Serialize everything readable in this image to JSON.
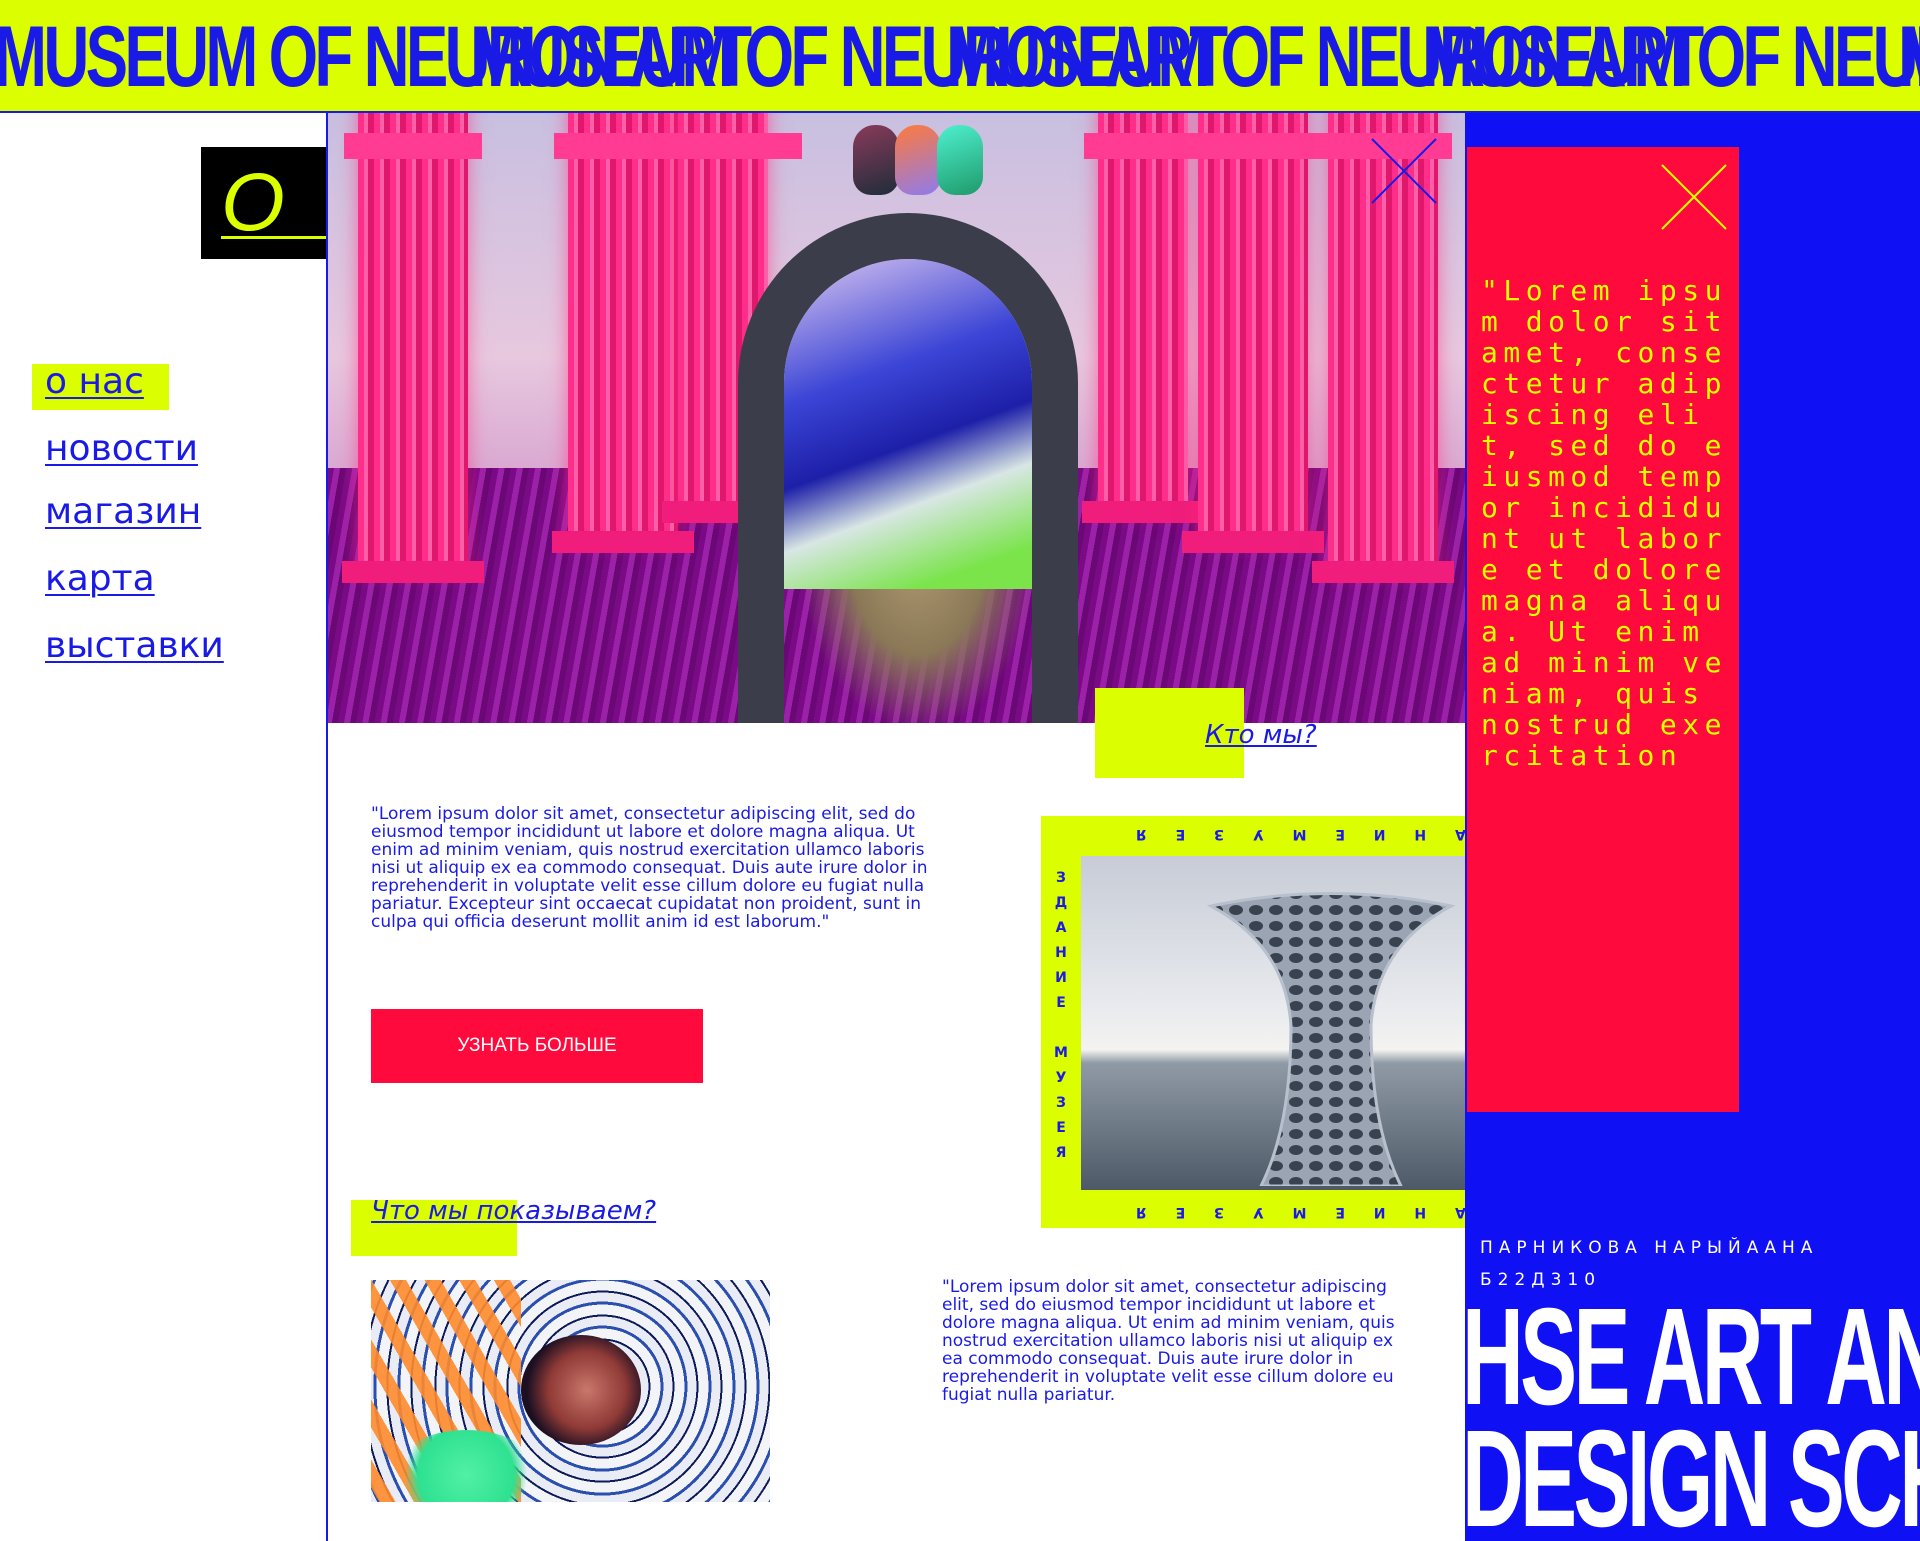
{
  "marquee": {
    "text": "MUSEUM OF NEURON ART",
    "repeats": 5
  },
  "page_title": "О НАС",
  "nav": {
    "active": 0,
    "items": [
      {
        "label": "о нас"
      },
      {
        "label": "новости"
      },
      {
        "label": "магазин"
      },
      {
        "label": "карта"
      },
      {
        "label": "выставки"
      }
    ]
  },
  "sections": {
    "who": {
      "heading": "Кто мы?"
    },
    "what": {
      "heading": "Что мы показываем?"
    }
  },
  "paragraphs": {
    "about": "\"Lorem ipsum dolor sit amet, consectetur adipiscing elit, sed do eiusmod tempor incididunt ut labore et dolore magna aliqua. Ut enim ad minim veniam, quis nostrud exercitation ullamco laboris nisi ut aliquip ex ea commodo consequat. Duis aute irure dolor in reprehenderit in voluptate velit esse cillum dolore eu fugiat nulla pariatur. Excepteur sint occaecat cupidatat non proident, sunt in culpa qui officia deserunt mollit anim id est laborum.\"",
    "show": "\"Lorem ipsum dolor sit amet, consectetur adipiscing elit, sed do eiusmod tempor incididunt ut labore et dolore magna aliqua. Ut enim ad minim veniam, quis nostrud exercitation ullamco laboris nisi ut aliquip ex ea commodo consequat. Duis aute irure dolor in reprehenderit in voluptate velit esse cillum dolore eu fugiat nulla pariatur."
  },
  "cta": {
    "label": "УЗНАТЬ БОЛЬШЕ"
  },
  "building": {
    "caption": "здание музея",
    "caption_upper": "З Д А Н И Е   М У З Е Я"
  },
  "red_card": {
    "text": "\"Lorem ipsum dolor sit amet, consectetur adipiscing elit, sed do eiusmod tempor incididunt ut labore et dolore magna aliqua. Ut enim ad minim veniam, quis nostrud exercitation"
  },
  "author": {
    "name": "ПАРНИКОВА НАРЫЙААНА",
    "group": "Б22Д310"
  },
  "school": {
    "line1": "HSE ART AND",
    "line2": "DESIGN SCHO"
  },
  "icons": {
    "close": "close-icon"
  },
  "colors": {
    "accent": "#dcff00",
    "blue": "#1a1ae6",
    "red": "#ff0a3c",
    "royal": "#1010f5"
  }
}
